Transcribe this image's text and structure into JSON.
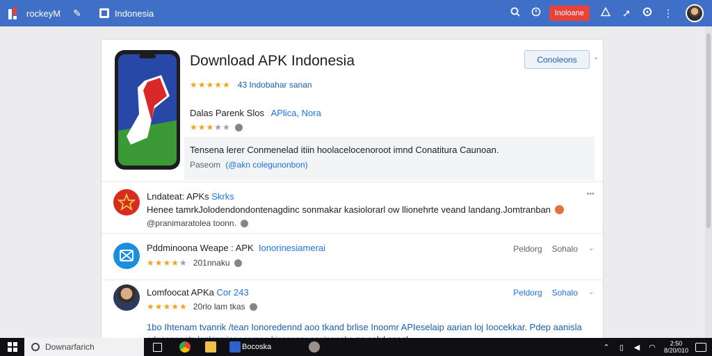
{
  "topbar": {
    "brand": "rockeyM",
    "tab_label": "Indonesia",
    "action_label": "Inoloane",
    "icons": [
      "search-icon",
      "clock-icon",
      "warning-icon",
      "send-icon",
      "gear-icon",
      "more-vertical-icon"
    ]
  },
  "app": {
    "title": "Download APK Indonesia",
    "reviews_text": "43 Indobahar sanan",
    "developer": "Dalas Parenk Slos",
    "category": "APlica, Nora",
    "description": "Tensena lerer Conmenelad itiin hoolacelocenoroot imnd Conatitura Caunoan.",
    "desc_prefix": "Paseom",
    "desc_link": "(@akn colegunonbon)",
    "cta_label": "Conoleons",
    "stars": 5,
    "secondary_rating": 3.5
  },
  "list": [
    {
      "title": "Lndateat: APKs",
      "tag": "Skrks",
      "line": "Henee tamrkJolodendondontenagdinc sonmakar kasiolorarl ow llionehrte veand landang.Jomtranban",
      "sub": "@pranimaratolea toonn.",
      "actions": []
    },
    {
      "title": "Pddminoona Weape : APK",
      "tag": "Ionorinesiamerai",
      "sub": "201nnaku",
      "rating": 4,
      "actions": [
        "Peldorg",
        "Sohalo"
      ]
    },
    {
      "title": "Lomfoocat APKa",
      "tag": "Cor 243",
      "sub": "20rlo lam tkas",
      "rating": 5,
      "line": "1bo Ihtenam tvanrik /tean Ionoredennd aoo tkand brlise Inoomr APIeselaip aarian loj Ioocekkar. Pdep aanisla",
      "line2": "odooonoeotn lonkinnrionaoarnoa hiesnoanr oaoinannbo nn",
      "line2_link": "oolul ooaol",
      "actions": [
        "Peldorg",
        "Sohalo"
      ]
    }
  ],
  "taskbar": {
    "search_placeholder": "Downarfarich",
    "app_label": "Bocoska",
    "clock_time": "2:50",
    "clock_date": "8/20/010"
  },
  "colors": {
    "topbar": "#3f6fc6",
    "accent": "#1a73e8",
    "star": "#f2a51a",
    "danger": "#e8433a"
  }
}
